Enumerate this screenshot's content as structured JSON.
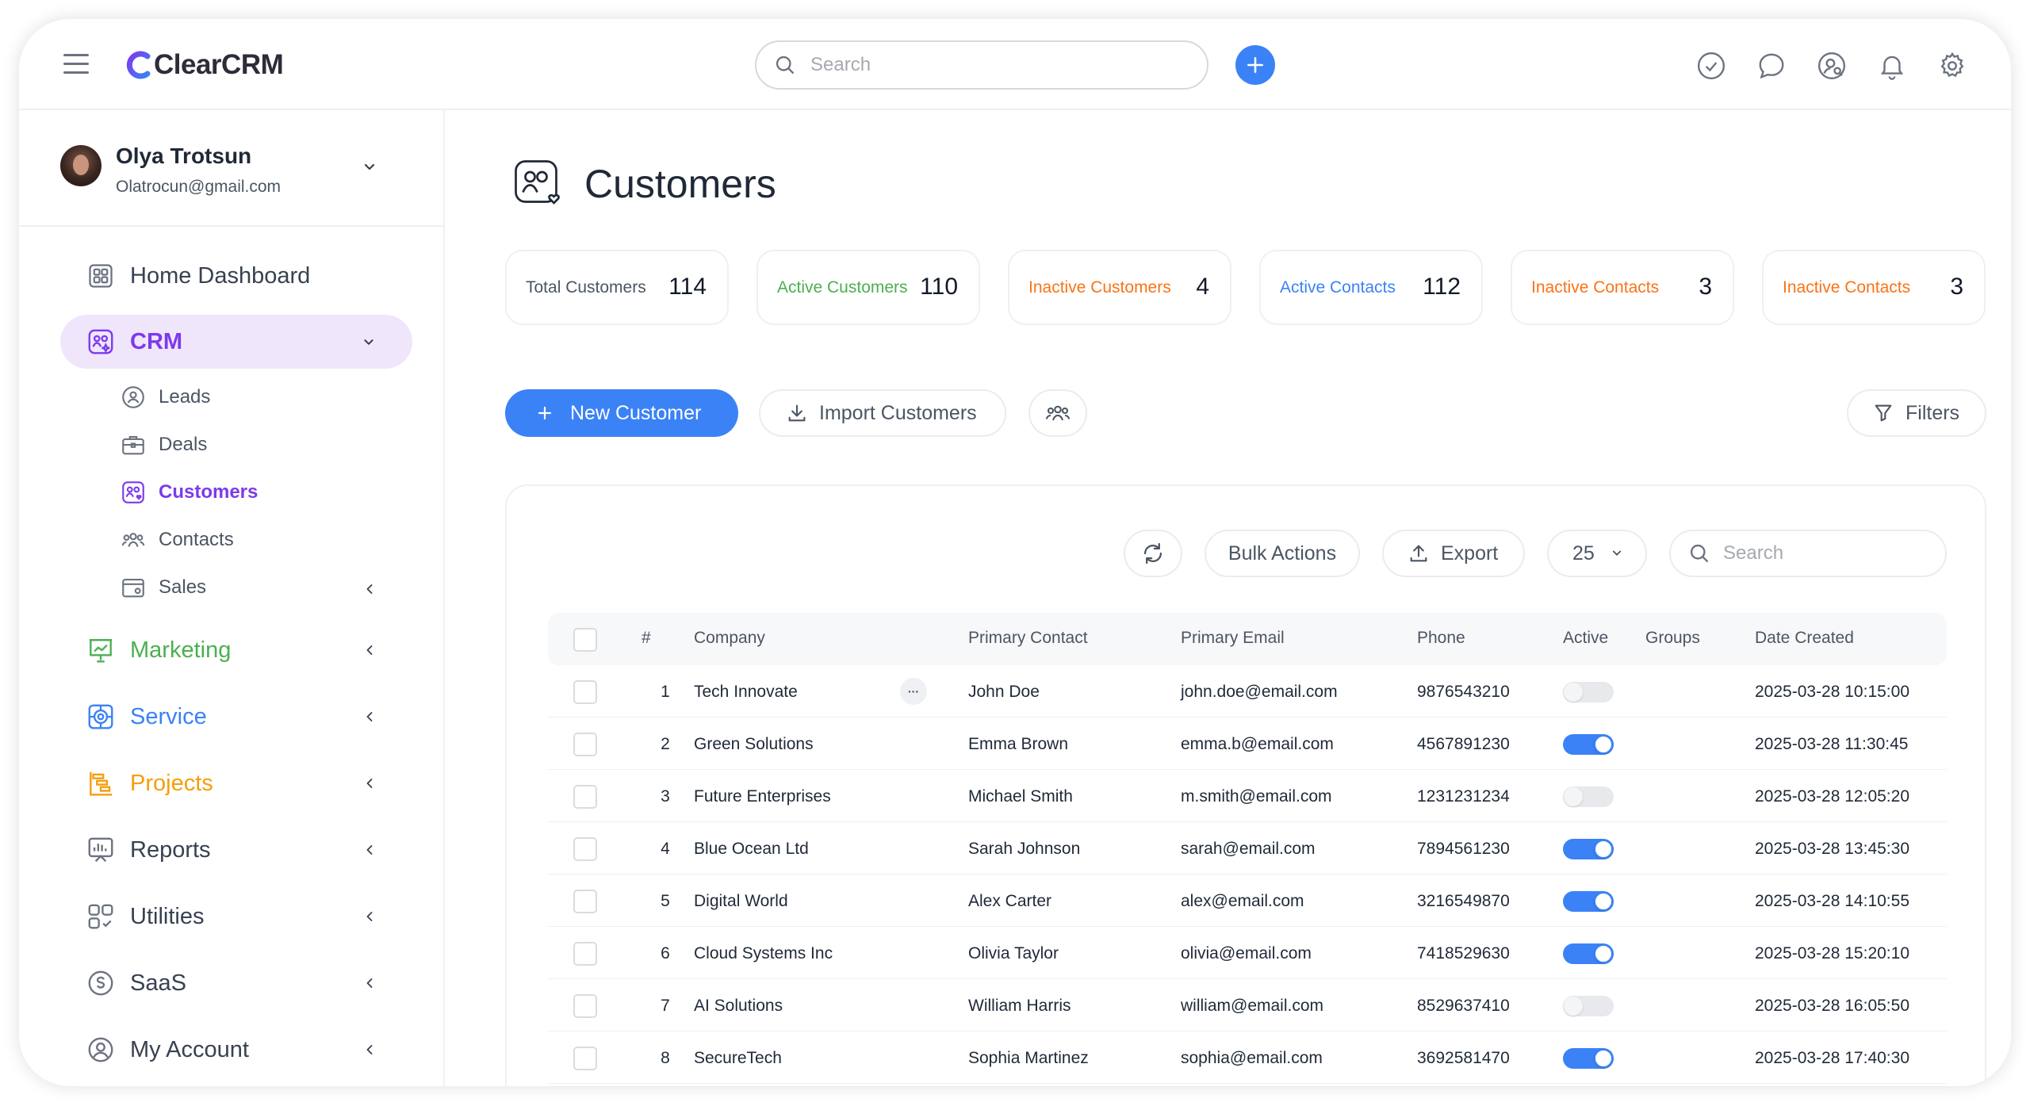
{
  "app": {
    "name": "ClearCRM"
  },
  "topbar": {
    "search_placeholder": "Search",
    "icons": [
      "menu-icon",
      "plus-icon",
      "check-circle-icon",
      "chat-icon",
      "user-search-icon",
      "bell-icon",
      "gear-icon"
    ]
  },
  "profile": {
    "name": "Olya Trotsun",
    "email": "Olatrocun@gmail.com"
  },
  "nav": {
    "home": "Home Dashboard",
    "crm": "CRM",
    "crm_sub": {
      "leads": "Leads",
      "deals": "Deals",
      "customers": "Customers",
      "contacts": "Contacts",
      "sales": "Sales"
    },
    "marketing": "Marketing",
    "service": "Service",
    "projects": "Projects",
    "reports": "Reports",
    "utilities": "Utilities",
    "saas": "SaaS",
    "my_account": "My Account"
  },
  "colors": {
    "accent": "#3b82f6",
    "crm": "#7c3aed",
    "crm_bg": "#efe6fc",
    "marketing": "#4caf50",
    "service": "#3b82f6",
    "projects": "#f59e0b",
    "active_stat": "#4caf50",
    "inactive_stat": "#f97316",
    "contacts_stat": "#3b82f6"
  },
  "page": {
    "title": "Customers"
  },
  "stats": [
    {
      "label": "Total Customers",
      "value": "114"
    },
    {
      "label": "Active Customers",
      "value": "110"
    },
    {
      "label": "Inactive Customers",
      "value": "4"
    },
    {
      "label": "Active Contacts",
      "value": "112"
    },
    {
      "label": "Inactive Contacts",
      "value": "3"
    },
    {
      "label": "Inactive Contacts",
      "value": "3"
    }
  ],
  "actions": {
    "new_customer": "New Customer",
    "import": "Import Customers",
    "filters": "Filters"
  },
  "table_toolbar": {
    "bulk_actions": "Bulk Actions",
    "export": "Export",
    "page_size": "25",
    "search_placeholder": "Search"
  },
  "table": {
    "headers": [
      "#",
      "Company",
      "Primary Contact",
      "Primary Email",
      "Phone",
      "Active",
      "Groups",
      "Date Created"
    ],
    "rows": [
      {
        "num": "1",
        "company": "Tech Innovate",
        "contact": "John Doe",
        "email": "john.doe@email.com",
        "phone": "9876543210",
        "active": false,
        "groups": "",
        "date": "2025-03-28 10:15:00"
      },
      {
        "num": "2",
        "company": "Green Solutions",
        "contact": "Emma Brown",
        "email": "emma.b@email.com",
        "phone": "4567891230",
        "active": true,
        "groups": "",
        "date": "2025-03-28 11:30:45"
      },
      {
        "num": "3",
        "company": "Future Enterprises",
        "contact": "Michael Smith",
        "email": "m.smith@email.com",
        "phone": "1231231234",
        "active": false,
        "groups": "",
        "date": "2025-03-28 12:05:20"
      },
      {
        "num": "4",
        "company": "Blue Ocean Ltd",
        "contact": "Sarah Johnson",
        "email": "sarah@email.com",
        "phone": "7894561230",
        "active": true,
        "groups": "",
        "date": "2025-03-28 13:45:30"
      },
      {
        "num": "5",
        "company": "Digital World",
        "contact": "Alex Carter",
        "email": "alex@email.com",
        "phone": "3216549870",
        "active": true,
        "groups": "",
        "date": "2025-03-28 14:10:55"
      },
      {
        "num": "6",
        "company": "Cloud Systems Inc",
        "contact": "Olivia Taylor",
        "email": "olivia@email.com",
        "phone": "7418529630",
        "active": true,
        "groups": "",
        "date": "2025-03-28 15:20:10"
      },
      {
        "num": "7",
        "company": "AI Solutions",
        "contact": "William Harris",
        "email": "william@email.com",
        "phone": "8529637410",
        "active": false,
        "groups": "",
        "date": "2025-03-28 16:05:50"
      },
      {
        "num": "8",
        "company": "SecureTech",
        "contact": "Sophia Martinez",
        "email": "sophia@email.com",
        "phone": "3692581470",
        "active": true,
        "groups": "",
        "date": "2025-03-28 17:40:30"
      }
    ]
  }
}
